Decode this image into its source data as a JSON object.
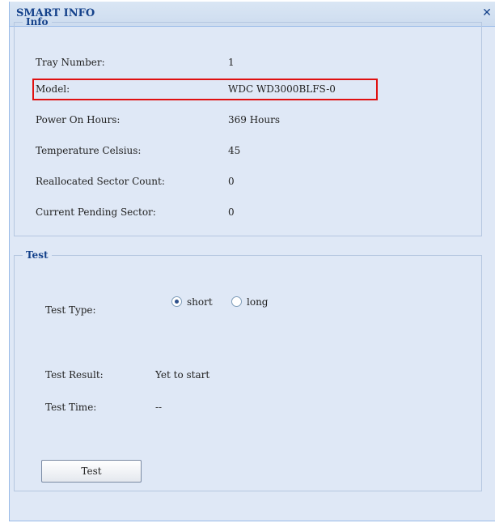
{
  "dialog": {
    "title": "SMART INFO",
    "close_glyph": "✕"
  },
  "info": {
    "legend": "Info",
    "rows": [
      {
        "label": "Tray Number:",
        "value": "1"
      },
      {
        "label": "Model:",
        "value": "WDC WD3000BLFS-0"
      },
      {
        "label": "Power On Hours:",
        "value": "369 Hours"
      },
      {
        "label": "Temperature Celsius:",
        "value": "45"
      },
      {
        "label": "Reallocated Sector Count:",
        "value": "0"
      },
      {
        "label": "Current Pending Sector:",
        "value": "0"
      }
    ]
  },
  "test": {
    "legend": "Test",
    "type_label": "Test Type:",
    "options": [
      {
        "label": "short",
        "selected": true
      },
      {
        "label": "long",
        "selected": false
      }
    ],
    "result_label": "Test Result:",
    "result_value": "Yet to start",
    "time_label": "Test Time:",
    "time_value": "--",
    "button_label": "Test"
  },
  "colors": {
    "title": "#15428b",
    "highlight": "#e01010",
    "panel": "#dfe8f6"
  }
}
